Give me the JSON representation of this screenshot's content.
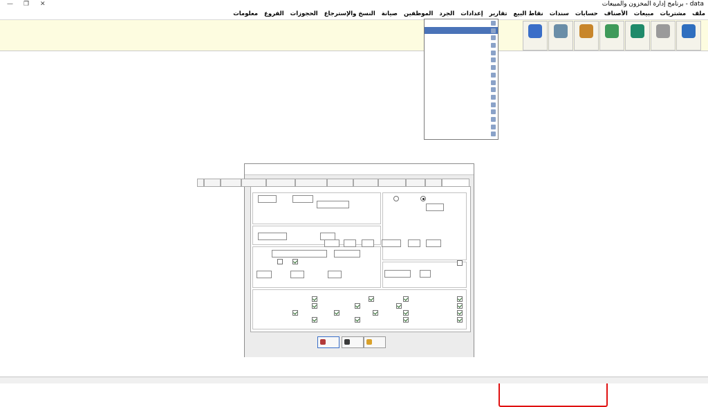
{
  "window": {
    "title": "برنامج إدارة المخزون والمبيعات - data"
  },
  "menubar": {
    "items": [
      {
        "label": "ملف"
      },
      {
        "label": "مشتريات"
      },
      {
        "label": "مبيعات"
      },
      {
        "label": "الأصناف"
      },
      {
        "label": "حسابات"
      },
      {
        "label": "سندات"
      },
      {
        "label": "نقاط البيع"
      },
      {
        "label": "تقارير"
      },
      {
        "label": "إعدادات"
      },
      {
        "label": "الجرد"
      },
      {
        "label": "الموظفين"
      },
      {
        "label": "صيانة"
      },
      {
        "label": "النسخ والإسترجاع"
      },
      {
        "label": "الحجوزات"
      },
      {
        "label": "الفروع"
      },
      {
        "label": "معلومات"
      }
    ]
  },
  "toolbar": {
    "button_colors": [
      "#2f6fbf",
      "#9a9a9a",
      "#1f8a6a",
      "#3f9a5a",
      "#c8862a",
      "#6a8ea8",
      "#3a6ec8"
    ]
  },
  "colors": {
    "toolbar_bg": "#fdfce0",
    "menu_selection": "#4a73b8",
    "highlight_box": "#e01010"
  }
}
